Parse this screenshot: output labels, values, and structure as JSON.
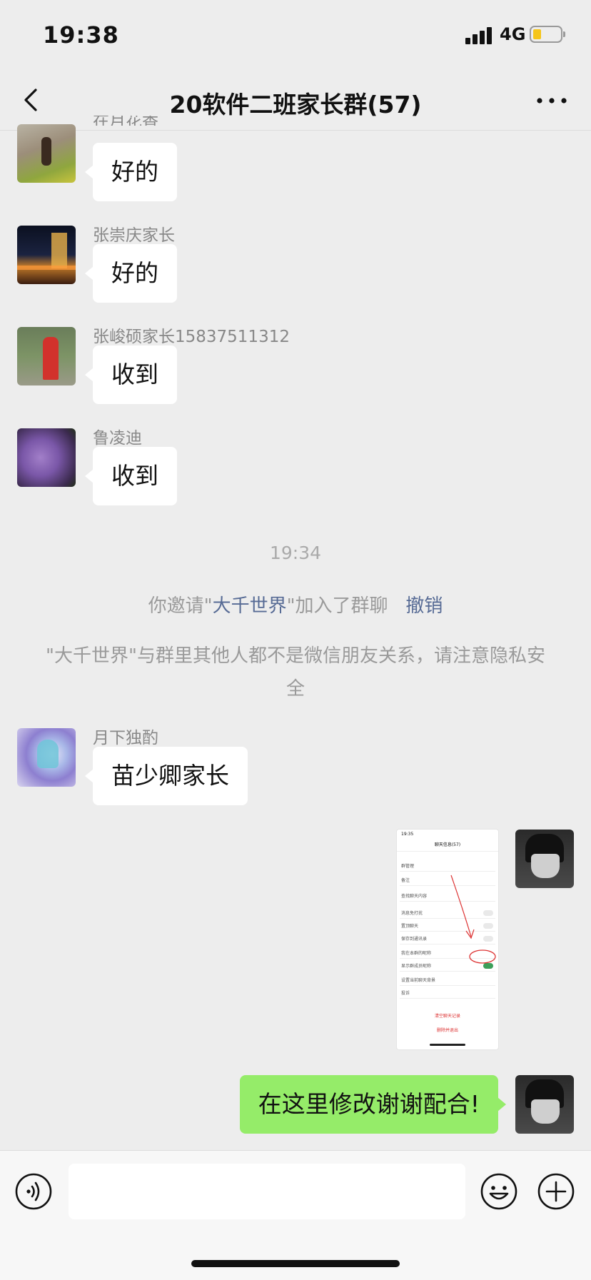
{
  "status": {
    "time": "19:38",
    "network": "4G"
  },
  "nav": {
    "title": "20软件二班家长群(57)"
  },
  "messages": [
    {
      "sender": "在月花香",
      "text": "好的"
    },
    {
      "sender": "张崇庆家长",
      "text": "好的"
    },
    {
      "sender": "张峻硕家长15837511312",
      "text": "收到"
    },
    {
      "sender": "鲁凌迪",
      "text": "收到"
    },
    {
      "sender": "月下独酌",
      "text": "苗少卿家长"
    }
  ],
  "system": {
    "time": "19:34",
    "invite_prefix": "你邀请\"",
    "invite_name": "大千世界",
    "invite_suffix": "\"加入了群聊",
    "undo": "撤销",
    "notice": "\"大千世界\"与群里其他人都不是微信朋友关系，请注意隐私安全"
  },
  "screenshot": {
    "time": "19:35",
    "title": "聊天信息(57)",
    "rows": [
      "群管理",
      "备注",
      "查找聊天内容",
      "消息免打扰",
      "置顶聊天",
      "保存到通讯录",
      "我在本群的昵称",
      "显示群成员昵称",
      "设置当前聊天背景",
      "投诉"
    ],
    "clear": "清空聊天记录",
    "exit": "删除并退出"
  },
  "my_message": {
    "text": "在这里修改谢谢配合!"
  },
  "colors": {
    "bubble_mine": "#95ec69",
    "link": "#576b95",
    "background": "#ededed"
  },
  "icons": [
    "back-icon",
    "more-icon",
    "voice-icon",
    "emoji-icon",
    "plus-icon"
  ]
}
